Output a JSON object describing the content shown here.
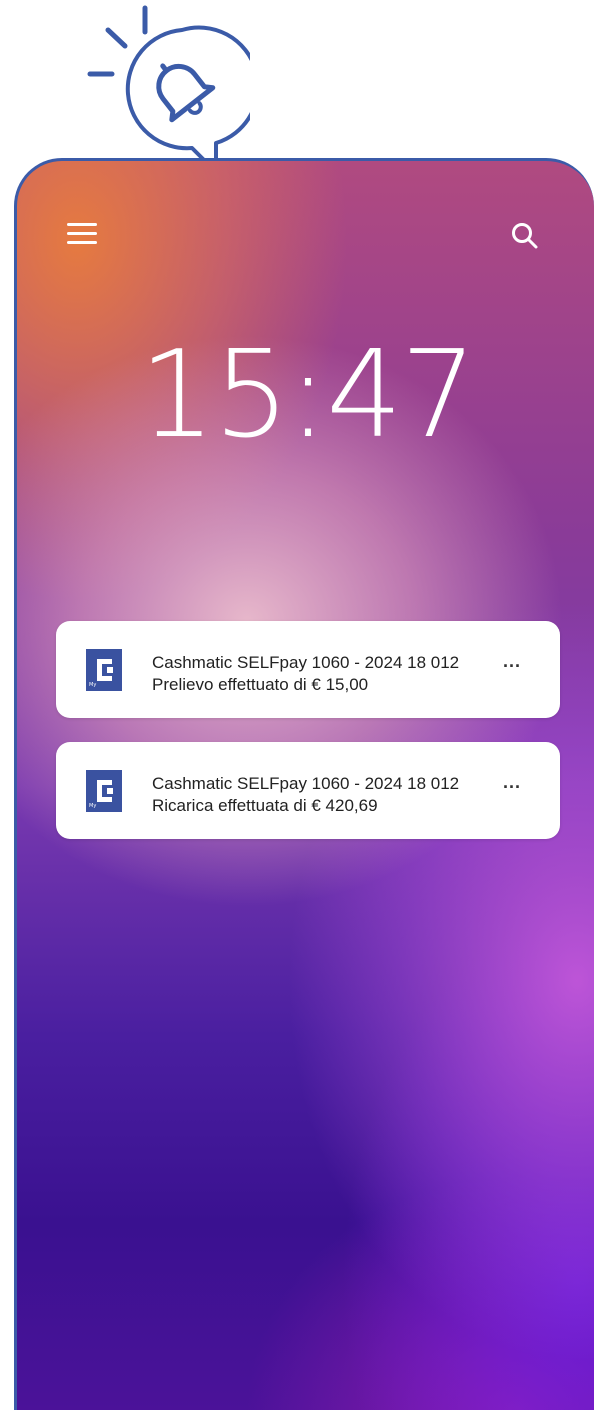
{
  "header": {
    "menu_icon": "hamburger-menu-icon",
    "search_icon": "search-icon"
  },
  "lockscreen": {
    "time": "15:47"
  },
  "notifications": [
    {
      "app_icon": "myc-app-icon",
      "app_icon_label": "My",
      "title": "Cashmatic SELFpay 1060 - 2024 18 012",
      "body": "Prelievo effettuato di € 15,00",
      "more": "..."
    },
    {
      "app_icon": "myc-app-icon",
      "app_icon_label": "My",
      "title": "Cashmatic SELFpay 1060 - 2024 18 012",
      "body": "Ricarica effettuata di € 420,69",
      "more": "..."
    }
  ],
  "colors": {
    "accent": "#3b5ba8",
    "app_icon_bg": "#3a52a0",
    "card_bg": "#ffffff",
    "text": "#222222"
  }
}
